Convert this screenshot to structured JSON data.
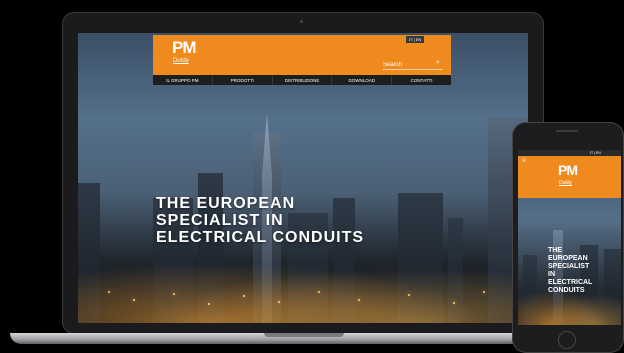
{
  "laptop_site": {
    "logo": "PM",
    "logo_sub": "Dutdy",
    "lang": "IT | EN",
    "search_placeholder": "Search",
    "nav": [
      "IL GRUPPO PM",
      "PRODOTTI",
      "DISTRIBUZIONE",
      "DOWNLOAD",
      "CONTATTI"
    ],
    "hero_lines": [
      "THE EUROPEAN",
      "SPECIALIST IN",
      "ELECTRICAL CONDUITS"
    ]
  },
  "phone_site": {
    "logo": "PM",
    "logo_sub": "Dutdy",
    "lang": "IT | EN",
    "hero_lines": [
      "THE",
      "EUROPEAN",
      "SPECIALIST",
      "IN",
      "ELECTRICAL",
      "CONDUITS"
    ]
  },
  "colors": {
    "brand_orange": "#ee8a1e",
    "nav_dark": "#1e1e1e"
  }
}
